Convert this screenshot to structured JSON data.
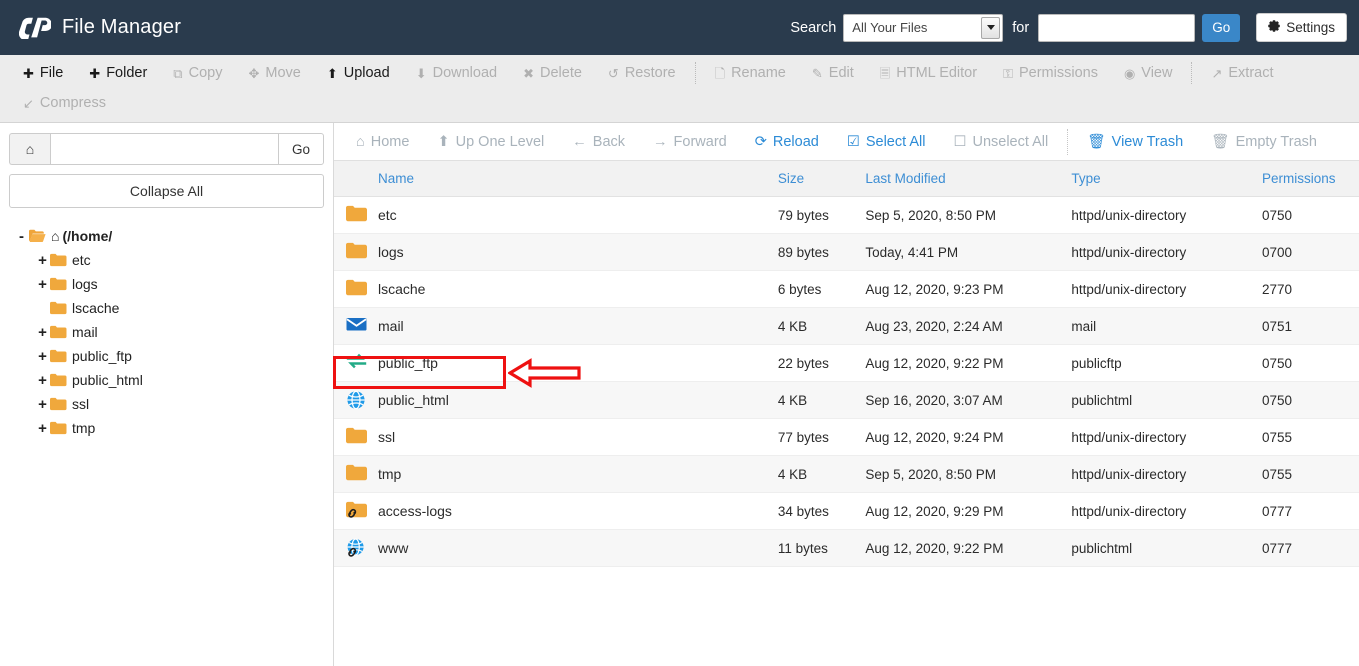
{
  "header": {
    "brand_logo": "cp-logo-icon",
    "title": "File Manager",
    "search_label": "Search",
    "search_scope_selected": "All Your Files",
    "for_label": "for",
    "search_value": "",
    "search_placeholder": "",
    "go_label": "Go",
    "settings_label": "Settings",
    "bg_color": "#2a3b4d",
    "accent_color": "#3a87c8"
  },
  "toolbar": {
    "items": [
      {
        "label": "File",
        "icon": "plus-icon",
        "enabled": true
      },
      {
        "label": "Folder",
        "icon": "plus-icon",
        "enabled": true
      },
      {
        "label": "Copy",
        "icon": "copy-icon",
        "enabled": false
      },
      {
        "label": "Move",
        "icon": "move-icon",
        "enabled": false
      },
      {
        "label": "Upload",
        "icon": "upload-icon",
        "enabled": true
      },
      {
        "label": "Download",
        "icon": "download-icon",
        "enabled": false
      },
      {
        "label": "Delete",
        "icon": "delete-icon",
        "enabled": false
      },
      {
        "label": "Restore",
        "icon": "restore-icon",
        "enabled": false
      },
      {
        "label": "Rename",
        "icon": "rename-icon",
        "enabled": false
      },
      {
        "label": "Edit",
        "icon": "edit-icon",
        "enabled": false
      },
      {
        "label": "HTML Editor",
        "icon": "html-editor-icon",
        "enabled": false
      },
      {
        "label": "Permissions",
        "icon": "key-icon",
        "enabled": false
      },
      {
        "label": "View",
        "icon": "eye-icon",
        "enabled": false
      },
      {
        "label": "Extract",
        "icon": "extract-icon",
        "enabled": false
      },
      {
        "label": "Compress",
        "icon": "compress-icon",
        "enabled": false
      }
    ]
  },
  "sidebar": {
    "path_value": "",
    "path_placeholder": "",
    "home_icon": "home-icon",
    "go_label": "Go",
    "collapse_all_label": "Collapse All",
    "tree": {
      "root": {
        "label": "(/home/",
        "toggle": "-",
        "icon": "open-folder-icon",
        "home_icon": "home-icon"
      },
      "children": [
        {
          "label": "etc",
          "toggle": "+"
        },
        {
          "label": "logs",
          "toggle": "+"
        },
        {
          "label": "lscache",
          "toggle": ""
        },
        {
          "label": "mail",
          "toggle": "+"
        },
        {
          "label": "public_ftp",
          "toggle": "+"
        },
        {
          "label": "public_html",
          "toggle": "+"
        },
        {
          "label": "ssl",
          "toggle": "+"
        },
        {
          "label": "tmp",
          "toggle": "+"
        }
      ]
    }
  },
  "navbar": {
    "items": [
      {
        "label": "Home",
        "icon": "home-icon",
        "active": false
      },
      {
        "label": "Up One Level",
        "icon": "up-arrow-icon",
        "active": false
      },
      {
        "label": "Back",
        "icon": "back-arrow-icon",
        "active": false
      },
      {
        "label": "Forward",
        "icon": "forward-arrow-icon",
        "active": false
      },
      {
        "label": "Reload",
        "icon": "reload-icon",
        "active": true
      },
      {
        "label": "Select All",
        "icon": "checkbox-checked-icon",
        "active": true
      },
      {
        "label": "Unselect All",
        "icon": "checkbox-empty-icon",
        "active": false
      },
      {
        "label": "View Trash",
        "icon": "trash-icon",
        "active": true
      },
      {
        "label": "Empty Trash",
        "icon": "trash-icon",
        "active": false
      }
    ]
  },
  "file_table": {
    "columns": [
      "Name",
      "Size",
      "Last Modified",
      "Type",
      "Permissions"
    ],
    "rows": [
      {
        "name": "etc",
        "icon": "folder-icon",
        "size": "79 bytes",
        "modified": "Sep 5, 2020, 8:50 PM",
        "type": "httpd/unix-directory",
        "permissions": "0750"
      },
      {
        "name": "logs",
        "icon": "folder-icon",
        "size": "89 bytes",
        "modified": "Today, 4:41 PM",
        "type": "httpd/unix-directory",
        "permissions": "0700"
      },
      {
        "name": "lscache",
        "icon": "folder-icon",
        "size": "6 bytes",
        "modified": "Aug 12, 2020, 9:23 PM",
        "type": "httpd/unix-directory",
        "permissions": "2770"
      },
      {
        "name": "mail",
        "icon": "mail-icon",
        "size": "4 KB",
        "modified": "Aug 23, 2020, 2:24 AM",
        "type": "mail",
        "permissions": "0751"
      },
      {
        "name": "public_ftp",
        "icon": "ftp-icon",
        "size": "22 bytes",
        "modified": "Aug 12, 2020, 9:22 PM",
        "type": "publicftp",
        "permissions": "0750"
      },
      {
        "name": "public_html",
        "icon": "globe-icon",
        "size": "4 KB",
        "modified": "Sep 16, 2020, 3:07 AM",
        "type": "publichtml",
        "permissions": "0750"
      },
      {
        "name": "ssl",
        "icon": "folder-icon",
        "size": "77 bytes",
        "modified": "Aug 12, 2020, 9:24 PM",
        "type": "httpd/unix-directory",
        "permissions": "0755"
      },
      {
        "name": "tmp",
        "icon": "folder-icon",
        "size": "4 KB",
        "modified": "Sep 5, 2020, 8:50 PM",
        "type": "httpd/unix-directory",
        "permissions": "0755"
      },
      {
        "name": "access-logs",
        "icon": "folder-link-icon",
        "size": "34 bytes",
        "modified": "Aug 12, 2020, 9:29 PM",
        "type": "httpd/unix-directory",
        "permissions": "0777"
      },
      {
        "name": "www",
        "icon": "globe-link-icon",
        "size": "11 bytes",
        "modified": "Aug 12, 2020, 9:22 PM",
        "type": "publichtml",
        "permissions": "0777"
      }
    ]
  },
  "annotation": {
    "highlight_target": "public_html",
    "color": "#ee1111",
    "shapes": [
      "rectangle-highlight",
      "left-arrow"
    ]
  }
}
